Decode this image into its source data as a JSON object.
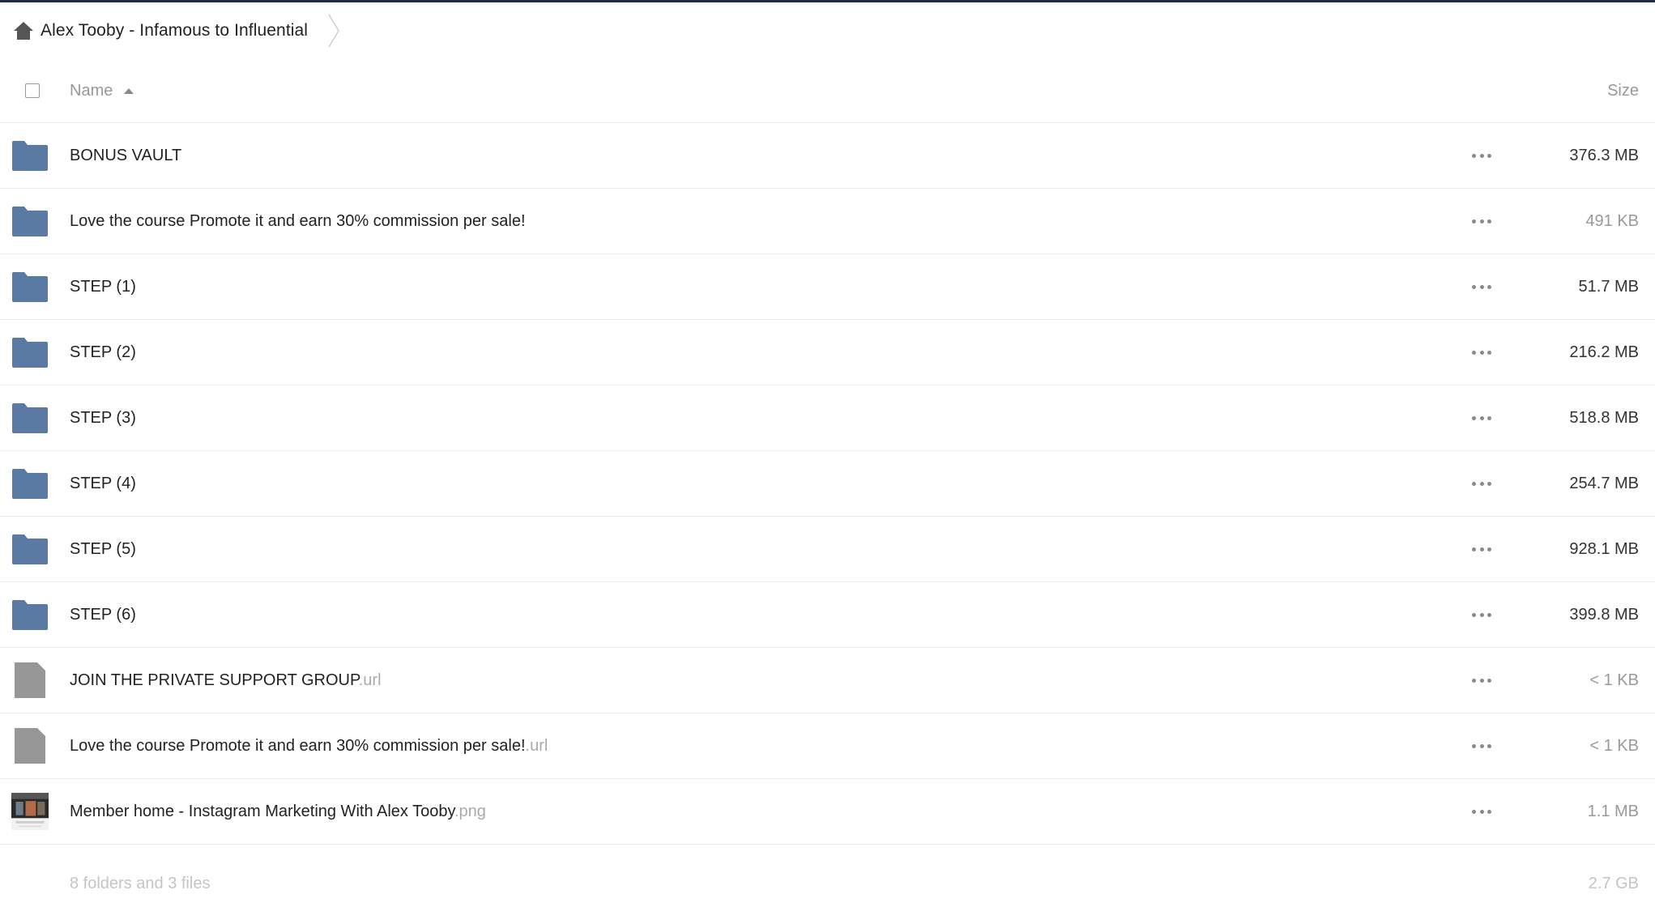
{
  "breadcrumb": {
    "home_icon": "home-icon",
    "label": "Alex Tooby - Infamous to Influential"
  },
  "header": {
    "name_label": "Name",
    "size_label": "Size"
  },
  "colors": {
    "folder": "#5b7aa3",
    "file": "#969696",
    "topbar": "#1d2d44"
  },
  "rows": [
    {
      "type": "folder",
      "name": "BONUS VAULT",
      "ext": "",
      "size": "376.3 MB",
      "size_faded": false
    },
    {
      "type": "folder",
      "name": "Love the course Promote it and earn 30% commission per sale!",
      "ext": "",
      "size": "491 KB",
      "size_faded": true
    },
    {
      "type": "folder",
      "name": "STEP (1)",
      "ext": "",
      "size": "51.7 MB",
      "size_faded": false
    },
    {
      "type": "folder",
      "name": "STEP (2)",
      "ext": "",
      "size": "216.2 MB",
      "size_faded": false
    },
    {
      "type": "folder",
      "name": "STEP (3)",
      "ext": "",
      "size": "518.8 MB",
      "size_faded": false
    },
    {
      "type": "folder",
      "name": "STEP (4)",
      "ext": "",
      "size": "254.7 MB",
      "size_faded": false
    },
    {
      "type": "folder",
      "name": "STEP (5)",
      "ext": "",
      "size": "928.1 MB",
      "size_faded": false
    },
    {
      "type": "folder",
      "name": "STEP (6)",
      "ext": "",
      "size": "399.8 MB",
      "size_faded": false
    },
    {
      "type": "file",
      "name": "JOIN THE PRIVATE SUPPORT GROUP",
      "ext": ".url",
      "size": "< 1 KB",
      "size_faded": true
    },
    {
      "type": "file",
      "name": "Love the course Promote it and earn 30% commission per sale!",
      "ext": ".url",
      "size": "< 1 KB",
      "size_faded": true
    },
    {
      "type": "image",
      "name": "Member home - Instagram Marketing With Alex Tooby",
      "ext": ".png",
      "size": "1.1 MB",
      "size_faded": true
    }
  ],
  "summary": {
    "text": "8 folders and 3 files",
    "size": "2.7 GB"
  }
}
